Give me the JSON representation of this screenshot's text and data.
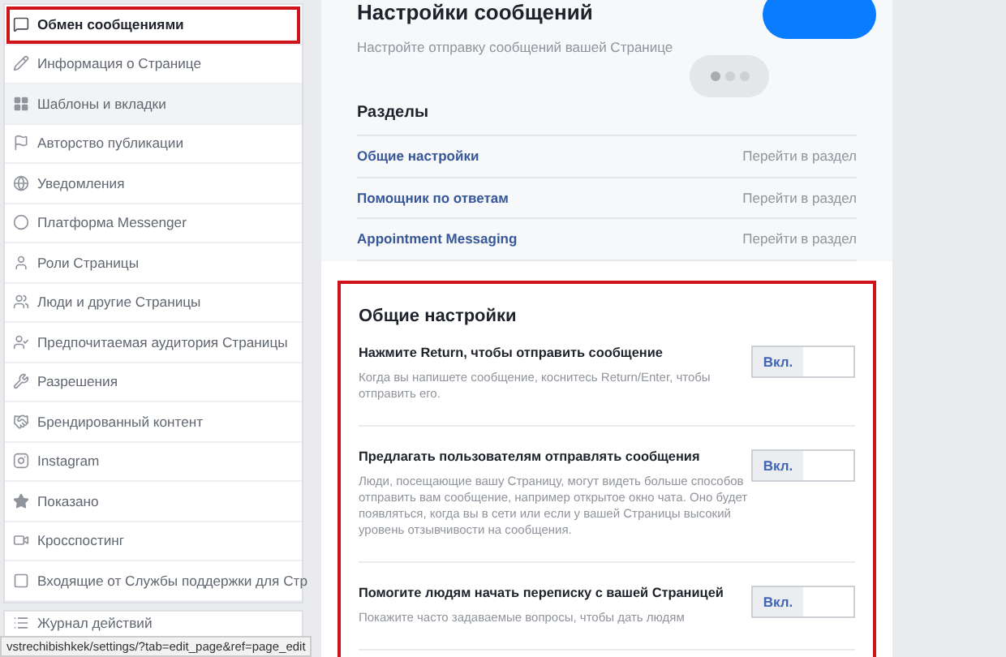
{
  "sidebar": {
    "items": [
      {
        "label": "Обмен сообщениями",
        "selected": true,
        "highlighted": false
      },
      {
        "label": "Информация о Странице",
        "selected": false,
        "highlighted": false
      },
      {
        "label": "Шаблоны и вкладки",
        "selected": false,
        "highlighted": true
      },
      {
        "label": "Авторство публикации",
        "selected": false,
        "highlighted": false
      },
      {
        "label": "Уведомления",
        "selected": false,
        "highlighted": false
      },
      {
        "label": "Платформа Messenger",
        "selected": false,
        "highlighted": false
      },
      {
        "label": "Роли Страницы",
        "selected": false,
        "highlighted": false
      },
      {
        "label": "Люди и другие Страницы",
        "selected": false,
        "highlighted": false
      },
      {
        "label": "Предпочитаемая аудитория Страницы",
        "selected": false,
        "highlighted": false
      },
      {
        "label": "Разрешения",
        "selected": false,
        "highlighted": false
      },
      {
        "label": "Брендированный контент",
        "selected": false,
        "highlighted": false
      },
      {
        "label": "Instagram",
        "selected": false,
        "highlighted": false
      },
      {
        "label": "Показано",
        "selected": false,
        "highlighted": false
      },
      {
        "label": "Кросспостинг",
        "selected": false,
        "highlighted": false
      },
      {
        "label": "Входящие от Службы поддержки для Стр",
        "selected": false,
        "highlighted": false
      }
    ],
    "journal": {
      "label": "Журнал действий"
    }
  },
  "status_bar": {
    "url": "vstrechibishkek/settings/?tab=edit_page&ref=page_edit"
  },
  "header": {
    "title": "Настройки сообщений",
    "subtitle": "Настройте отправку сообщений вашей Странице"
  },
  "sections": {
    "title": "Разделы",
    "rows": [
      {
        "name": "Общие настройки",
        "action": "Перейти в раздел"
      },
      {
        "name": "Помощник по ответам",
        "action": "Перейти в раздел"
      },
      {
        "name": "Appointment Messaging",
        "action": "Перейти в раздел"
      }
    ]
  },
  "general": {
    "title": "Общие настройки",
    "settings": [
      {
        "title": "Нажмите Return, чтобы отправить сообщение",
        "description": "Когда вы напишете сообщение, коснитесь Return/Enter, чтобы отправить его.",
        "toggle": "Вкл.",
        "on": true
      },
      {
        "title": "Предлагать пользователям отправлять сообщения",
        "description": "Люди, посещающие вашу Страницу, могут видеть больше способов отправить вам сообщение, например открытое окно чата. Оно будет появляться, когда вы в сети или если у вашей Страницы высокий уровень отзывчивости на сообщения.",
        "toggle": "Вкл.",
        "on": true
      },
      {
        "title": "Помогите людям начать переписку с вашей Страницей",
        "description": "Покажите часто задаваемые вопросы, чтобы дать людям",
        "toggle": "Вкл.",
        "on": true
      }
    ]
  }
}
